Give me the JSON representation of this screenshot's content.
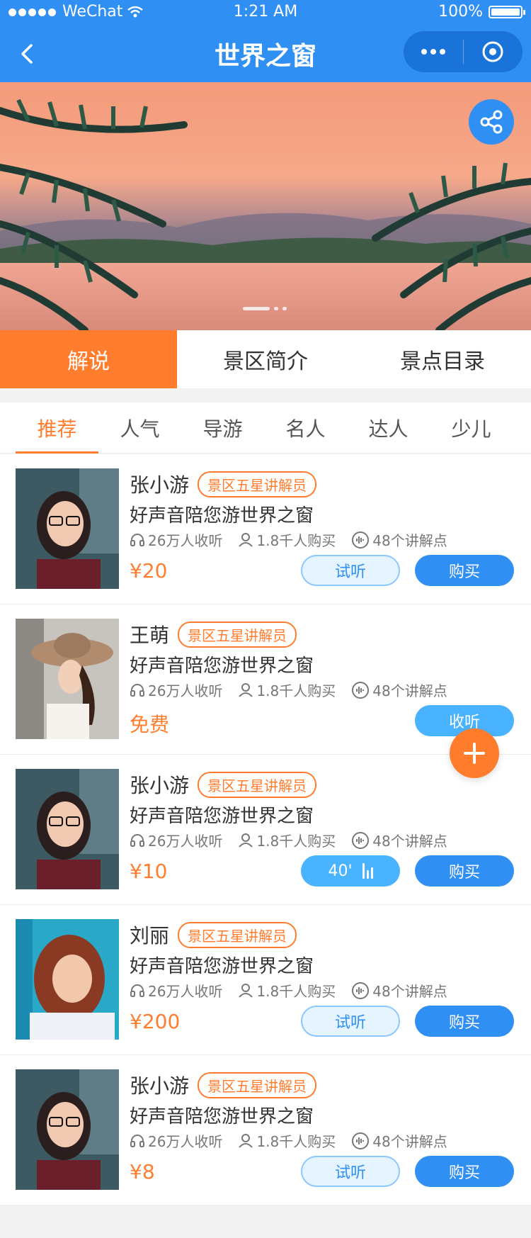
{
  "status_bar": {
    "carrier": "WeChat",
    "time": "1:21 AM",
    "battery": "100%"
  },
  "nav": {
    "title": "世界之窗"
  },
  "main_tabs": [
    {
      "label": "解说",
      "active": true
    },
    {
      "label": "景区简介",
      "active": false
    },
    {
      "label": "景点目录",
      "active": false
    }
  ],
  "sub_tabs": [
    {
      "label": "推荐",
      "active": true
    },
    {
      "label": "人气",
      "active": false
    },
    {
      "label": "导游",
      "active": false
    },
    {
      "label": "名人",
      "active": false
    },
    {
      "label": "达人",
      "active": false
    },
    {
      "label": "少儿",
      "active": false
    }
  ],
  "items": [
    {
      "name": "张小游",
      "badge": "景区五星讲解员",
      "desc": "好声音陪您游世界之窗",
      "listens": "26万人收听",
      "buyers": "1.8千人购买",
      "points": "48个讲解点",
      "price": "¥20",
      "listen_label": "试听",
      "buy_label": "购买"
    },
    {
      "name": "王萌",
      "badge": "景区五星讲解员",
      "desc": "好声音陪您游世界之窗",
      "listens": "26万人收听",
      "buyers": "1.8千人购买",
      "points": "48个讲解点",
      "price": "免费",
      "buy_label": "收听"
    },
    {
      "name": "张小游",
      "badge": "景区五星讲解员",
      "desc": "好声音陪您游世界之窗",
      "listens": "26万人收听",
      "buyers": "1.8千人购买",
      "points": "48个讲解点",
      "price": "¥10",
      "audio_duration": "40'",
      "buy_label": "购买"
    },
    {
      "name": "刘丽",
      "badge": "景区五星讲解员",
      "desc": "好声音陪您游世界之窗",
      "listens": "26万人收听",
      "buyers": "1.8千人购买",
      "points": "48个讲解点",
      "price": "¥200",
      "listen_label": "试听",
      "buy_label": "购买"
    },
    {
      "name": "张小游",
      "badge": "景区五星讲解员",
      "desc": "好声音陪您游世界之窗",
      "listens": "26万人收听",
      "buyers": "1.8千人购买",
      "points": "48个讲解点",
      "price": "¥8",
      "listen_label": "试听",
      "buy_label": "购买"
    }
  ],
  "colors": {
    "primary": "#2f8ff3",
    "accent": "#ff7d2d"
  },
  "icons": [
    "back-icon",
    "more-icon",
    "target-icon",
    "share-icon",
    "headphones-icon",
    "user-icon",
    "audio-icon",
    "waveform-icon",
    "plus-icon"
  ]
}
